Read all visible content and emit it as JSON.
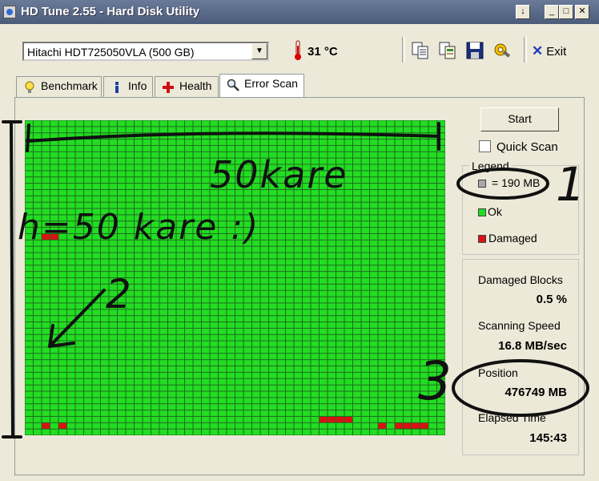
{
  "window": {
    "title": "HD Tune 2.55 - Hard Disk Utility",
    "controls": {
      "help": "↓",
      "minimize": "_",
      "maximize": "□",
      "close": "✕"
    }
  },
  "toolbar": {
    "drive": "Hitachi HDT725050VLA (500 GB)",
    "temperature": "31 °C",
    "exit_label": "Exit",
    "icons": [
      "copy-text-icon",
      "copy-info-icon",
      "save-icon",
      "options-icon",
      "exit-icon"
    ]
  },
  "tabs": [
    {
      "label": "Benchmark",
      "icon": "lightbulb-icon"
    },
    {
      "label": "Info",
      "icon": "info-icon"
    },
    {
      "label": "Health",
      "icon": "health-cross-icon"
    },
    {
      "label": "Error Scan",
      "icon": "magnifier-icon",
      "active": true
    }
  ],
  "scan": {
    "start_label": "Start",
    "quick_scan_label": "Quick Scan",
    "quick_scan_checked": false,
    "legend": {
      "title": "Legend",
      "block_size": "= 190 MB",
      "ok": "Ok",
      "damaged": "Damaged"
    },
    "stats": {
      "damaged_blocks_label": "Damaged Blocks",
      "damaged_blocks_value": "0.5 %",
      "scanning_speed_label": "Scanning Speed",
      "scanning_speed_value": "16.8 MB/sec",
      "position_label": "Position",
      "position_value": "476749 MB",
      "elapsed_time_label": "Elapsed Time",
      "elapsed_time_value": "145:43"
    },
    "grid": {
      "columns": 50,
      "rows": 50,
      "damaged_cells": [
        [
          18,
          2
        ],
        [
          18,
          3
        ],
        [
          48,
          2
        ],
        [
          48,
          4
        ],
        [
          47,
          35
        ],
        [
          47,
          36
        ],
        [
          47,
          37
        ],
        [
          47,
          38
        ],
        [
          48,
          42
        ],
        [
          48,
          44
        ],
        [
          48,
          45
        ],
        [
          48,
          46
        ],
        [
          48,
          47
        ]
      ],
      "colors": {
        "ok": "#22dd22",
        "damaged": "#dd1111",
        "grid_line": "#1f6b1f"
      }
    }
  },
  "annotations": {
    "top_text": "50kare",
    "side_text": "h=50 kare :)",
    "marker_1": "1",
    "marker_2": "2",
    "marker_3": "3"
  }
}
